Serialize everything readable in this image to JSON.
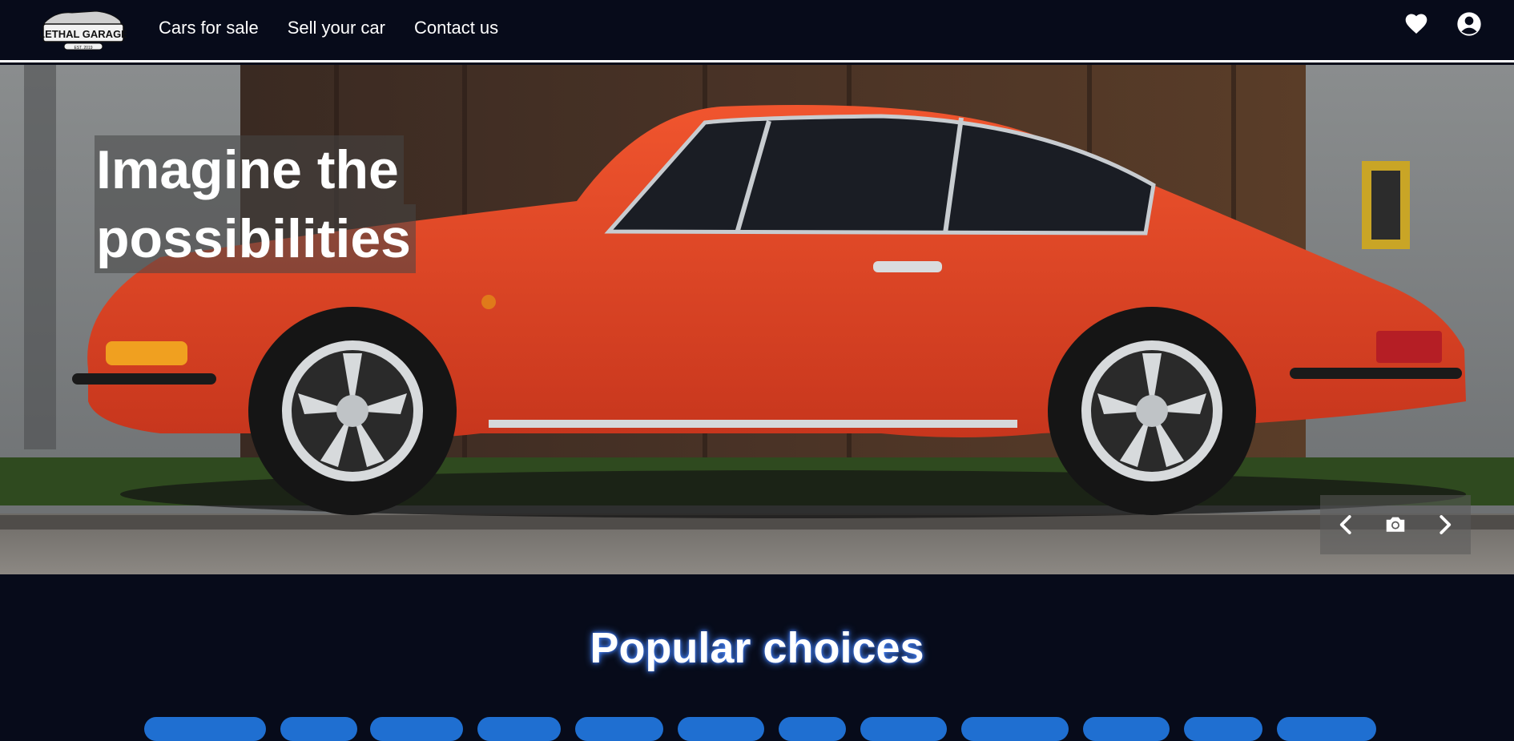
{
  "header": {
    "logo": {
      "text": "LETHAL GARAGE",
      "sub": "EST. 2019"
    },
    "nav": [
      {
        "label": "Cars for sale"
      },
      {
        "label": "Sell your car"
      },
      {
        "label": "Contact us"
      }
    ],
    "icons": [
      "heart-icon",
      "user-account-icon"
    ]
  },
  "hero": {
    "headline_line1": "Imagine the",
    "headline_line2": "possibilities",
    "controls": [
      "chevron-left-icon",
      "camera-icon",
      "chevron-right-icon"
    ]
  },
  "popular": {
    "title": "Popular choices",
    "chip_count": 12
  },
  "colors": {
    "background": "#070b1a",
    "car": "#e8452a",
    "chip": "#1f6fd1",
    "title_glow": "#4d8dff"
  }
}
